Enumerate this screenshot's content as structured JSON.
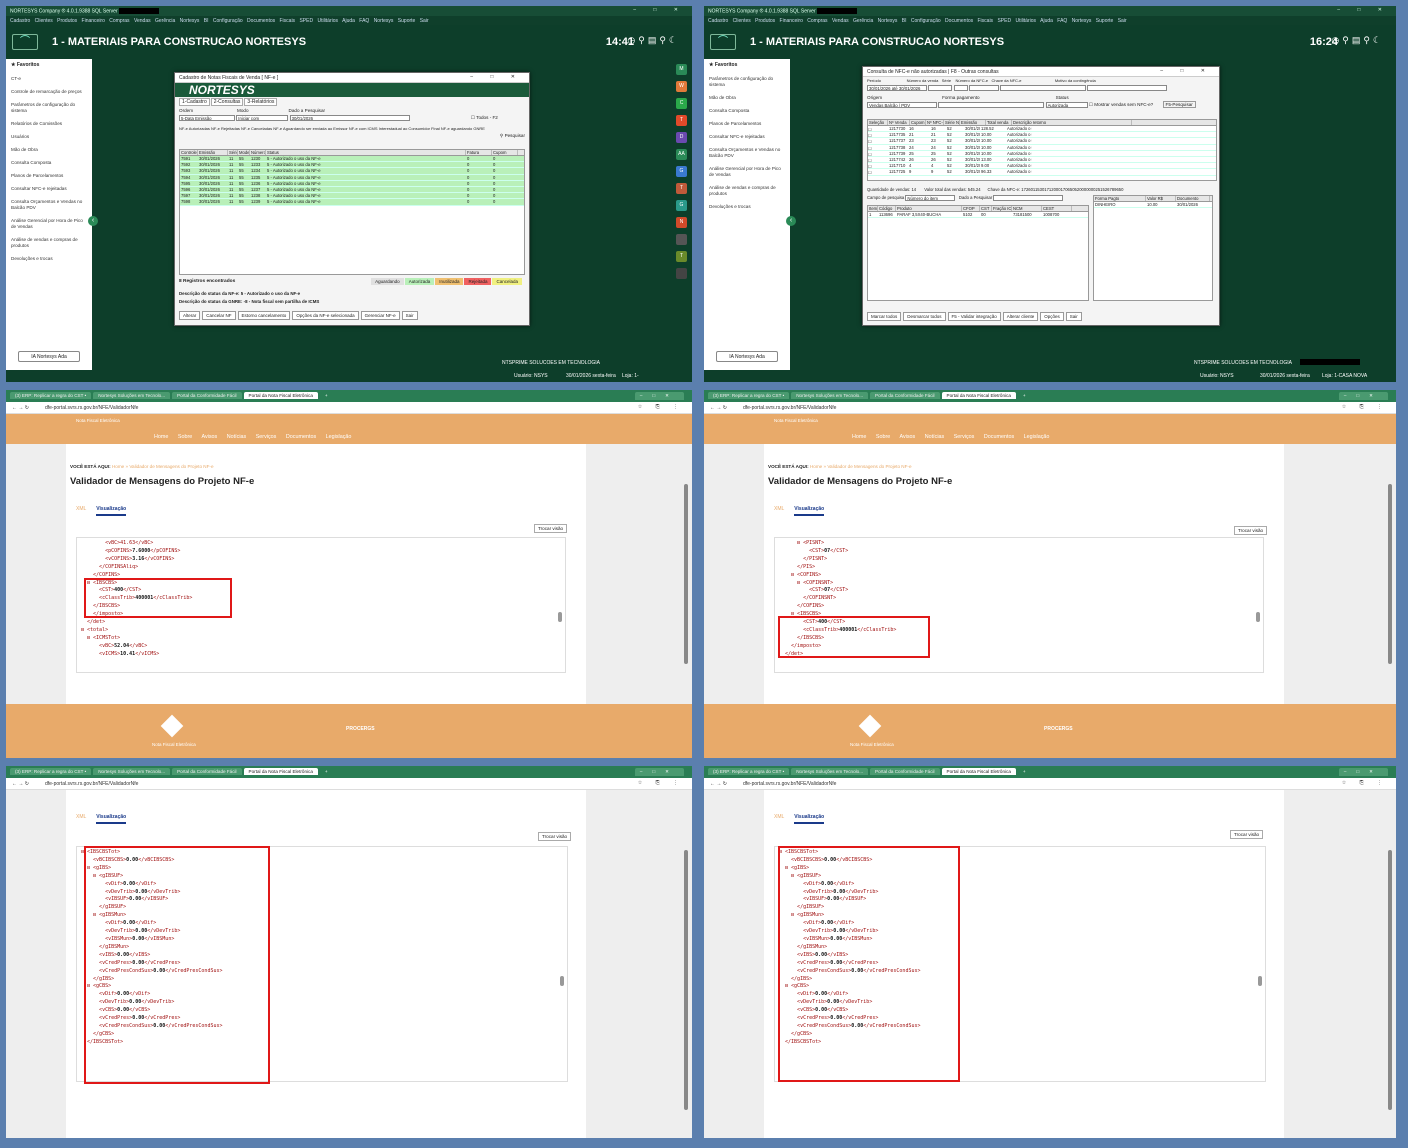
{
  "erp": {
    "window_title": "NORTESYS Company ® 4.0.1.9388 SQL Server",
    "menu": "Cadastro  Clientes  Produtos  Financeiro  Compras  Vendas  Gerência  Nortesys BI  Configuração  Documentos Fiscais  SPED  Utilitários  Ajuda  FAQ Nortesys  Suporte  Sair",
    "company": "1 - MATERIAIS PARA CONSTRUCAO NORTESYS",
    "favorites_label": "Favoritos",
    "ada_button": "IA Nortesys Ada",
    "footer_company": "NTSPRIME SOLUCOES EM TECNOLOGIA",
    "user": "Usuário: NSYS",
    "date": "30/01/2026 sexta-feira",
    "dock": [
      "M",
      "W",
      "C",
      "T",
      "D",
      "AA",
      "G",
      "T",
      "G",
      "N",
      "",
      "T",
      ""
    ]
  },
  "panel1": {
    "clock": "14:41",
    "sidebar": [
      "CT-e",
      "Controle de remarcação de preços",
      "Parâmetros de configuração do sistema",
      "Relatórios de Comissões",
      "Usuários",
      "Mão de Obra",
      "Consulta Composta",
      "Planos de Parcelamentos",
      "Consultar NFC-e rejeitadas",
      "Consulta Orçamentos e Vendas no Balcão PDV",
      "Análise Gerencial por Hora de Pico de Vendas",
      "Análise de vendas e compras de produtos",
      "Devoluções e trocas"
    ],
    "store": "Loja: 1-",
    "dialog": {
      "title": "Cadastro de Notas Fiscais de Venda [ NF-e ]",
      "banner": "NORTESYS",
      "tabs": [
        "1-Cadastro",
        "2-Consultas",
        "3-Relatórios"
      ],
      "ordem_label": "Ordem",
      "ordem_value": "5-Data Emissão",
      "modo_label": "Modo",
      "modo_value": "Iniciar com",
      "dado_label": "Dado a Pesquisar",
      "dado_value": "30/01/2026",
      "todos_label": "Todos - F2",
      "filters": "NF-e Autorizadas  NF-e Rejeitadas  NF-e Canceladas  NF-e Aguardando ser enviada ao Emissor  NF-e com ICMS Interestadual ao Consumidor Final  NF-e aguardando GNRE",
      "pesquisar": "Pesquisar",
      "columns": [
        "Controle",
        "Emissão",
        "Série",
        "Modelo",
        "Número",
        "Status",
        "Fatura",
        "Cupom"
      ],
      "rows": [
        [
          "7591",
          "30/01/2026",
          "11",
          "55",
          "1230",
          "5 - Autorizado o uso da NF-e",
          "0",
          "0"
        ],
        [
          "7592",
          "30/01/2026",
          "11",
          "55",
          "1233",
          "5 - Autorizado o uso da NF-e",
          "0",
          "0"
        ],
        [
          "7593",
          "30/01/2026",
          "11",
          "55",
          "1234",
          "5 - Autorizado o uso da NF-e",
          "0",
          "0"
        ],
        [
          "7594",
          "30/01/2026",
          "11",
          "55",
          "1235",
          "5 - Autorizado o uso da NF-e",
          "0",
          "0"
        ],
        [
          "7595",
          "30/01/2026",
          "11",
          "55",
          "1236",
          "5 - Autorizado o uso da NF-e",
          "0",
          "0"
        ],
        [
          "7596",
          "30/01/2026",
          "11",
          "55",
          "1237",
          "5 - Autorizado o uso da NF-e",
          "0",
          "0"
        ],
        [
          "7597",
          "30/01/2026",
          "11",
          "55",
          "1238",
          "5 - Autorizado o uso da NF-e",
          "0",
          "0"
        ],
        [
          "7598",
          "30/01/2026",
          "11",
          "55",
          "1239",
          "5 - Autorizado o uso da NF-e",
          "0",
          "0"
        ]
      ],
      "count": "8 Registros encontrados",
      "legend": [
        "Aguardando",
        "Autorizada",
        "Inutilizada",
        "Rejeitada",
        "Cancelada"
      ],
      "desc1": "Descrição do status da NF-e:  5 - Autorizado o uso da NF-e",
      "desc2": "Descrição do status da GNRE:  -8 - Nota fiscal sem partilha de ICMS",
      "buttons": [
        "Alterar",
        "Cancelar NF",
        "Estorno cancelamento",
        "Opções da NF-e selecionada",
        "Gerenciar NF-e",
        "Sair"
      ]
    }
  },
  "panel2": {
    "clock": "16:24",
    "sidebar": [
      "Parâmetros de configuração do sistema",
      "Mão de Obra",
      "Consulta Composta",
      "Planos de Parcelamentos",
      "Consultar NFC-e rejeitadas",
      "Consulta Orçamentos e Vendas no Balcão PDV",
      "Análise Gerencial por Hora de Pico de Vendas",
      "Análise de vendas e compras de produtos",
      "Devoluções e trocas"
    ],
    "store": "Loja: 1-CASA NOVA",
    "dialog": {
      "title": "Consulta de NFC-e não autorizadas | F8 - Outras consultas",
      "labels": "Período                       Número da venda   Série    Número da NFC-e   Chave da NFC-e                              Motivo da contingência",
      "periodo": "30/01/2026  até  30/01/2026",
      "origem_label": "Origem",
      "origem_value": "Vendas Balcão / PDV",
      "forma_label": "Forma pagamento",
      "status_label": "Status",
      "status_value": "Autorizada",
      "mostrar": "Mostrar vendas sem NFC-e?",
      "pesquisar": "F5-Pesquisar",
      "columns": [
        "Seleção",
        "Nº Venda",
        "Cupom",
        "Nº NFC-e",
        "Série NFC-e",
        "Emissão",
        "Total venda",
        "Descrição retorno"
      ],
      "rows": [
        [
          "1217730",
          "16",
          "16",
          "52",
          "30/01/2026",
          "128.52",
          "Autorizado o uso da NF-e"
        ],
        [
          "1217735",
          "21",
          "21",
          "52",
          "30/01/2026",
          "10.00",
          "Autorizado o uso da NF-e"
        ],
        [
          "1217737",
          "23",
          "23",
          "52",
          "30/01/2026",
          "10.00",
          "Autorizado o uso da NF-e"
        ],
        [
          "1217738",
          "24",
          "24",
          "52",
          "30/01/2026",
          "10.00",
          "Autorizado o uso da NF-e"
        ],
        [
          "1217739",
          "25",
          "25",
          "52",
          "30/01/2026",
          "10.00",
          "Autorizado o uso da NF-e"
        ],
        [
          "1217742",
          "26",
          "26",
          "52",
          "30/01/2026",
          "13.00",
          "Autorizado o uso da NF-e"
        ],
        [
          "1217710",
          "4",
          "4",
          "52",
          "30/01/2026",
          "9.00",
          "Autorizado o uso da NF-e"
        ],
        [
          "1217725",
          "9",
          "9",
          "52",
          "30/01/2026",
          "96.33",
          "Autorizado o uso da NF-e"
        ]
      ],
      "qtd": "Quantidade de vendas:  14",
      "valor": "Valor total das vendas:  545.24",
      "chave": "Chave da NFC-e:  17260115301712000170650520000000251526789650",
      "campo_label": "Campo de pesquisa",
      "campo_value": "Número do item",
      "dado_label": "Dado a Pesquisar",
      "item_columns": [
        "Item",
        "Código",
        "Produto",
        "CFOP",
        "CST",
        "Fração ICMS",
        "NCM",
        "CEST"
      ],
      "item_row": [
        "1",
        "113696",
        "PARAF 3,5X40-BUCHA",
        "5102",
        "00",
        "",
        "73181500",
        "1008700"
      ],
      "pay_columns": [
        "Forma Pagto",
        "Valor R$",
        "Documento"
      ],
      "pay_row": [
        "DINHEIRO",
        "10.00",
        "30/01/2026"
      ],
      "buttons": [
        "Marcar todos",
        "Desmarcar todos",
        "F5 - Validar integração",
        "Alterar cliente",
        "Opções",
        "Sair"
      ]
    }
  },
  "browser": {
    "tabs": [
      "(3) ERP: Replicar a regra do CST •",
      "Nortesys Soluções em Tecnolo...",
      "Portal da Conformidade Fácil",
      "Portal da Nota Fiscal Eletrônica"
    ],
    "url": "dfe-portal.svrs.rs.gov.br/NFE/ValidadorNfe",
    "nav": "Home   Sobre   Avisos   Notícias   Serviços   Documentos   Legislação",
    "brand": "Nota Fiscal Eletrônica",
    "crumb_prefix": "VOCÊ ESTÁ AQUI:",
    "crumb_path": "Home  »  Validador de Mensagens do Projeto NF-e",
    "page_title": "Validador de Mensagens do Projeto NF-e",
    "tab_xml": "XML",
    "tab_vis": "Visualização",
    "trocar": "Trocar visão",
    "footer_name": "Nota Fiscal Eletrônica",
    "footer_partner": "PROCERGS"
  },
  "xml3": [
    [
      "        <vBC>41.63</vBC>",
      ""
    ],
    [
      "        <pCOFINS>",
      "7.6000",
      "</pCOFINS>"
    ],
    [
      "        <vCOFINS>",
      "3.16",
      "</vCOFINS>"
    ],
    [
      "      </COFINSAliq>",
      ""
    ],
    [
      "    </COFINS>",
      ""
    ],
    [
      "  ⊟ <IBSCBS>",
      ""
    ],
    [
      "      <CST>",
      "400",
      "</CST>"
    ],
    [
      "      <cClassTrib>",
      "400001",
      "</cClassTrib>"
    ],
    [
      "    </IBSCBS>",
      ""
    ],
    [
      "    </imposto>",
      ""
    ],
    [
      "  </det>",
      ""
    ],
    [
      "⊟ <total>",
      ""
    ],
    [
      "  ⊟ <ICMSTot>",
      ""
    ],
    [
      "      <vBC>",
      "52.04",
      "</vBC>"
    ],
    [
      "      <vICMS>",
      "10.41",
      "</vICMS>"
    ]
  ],
  "xml4": [
    [
      "      ⊟ <PISNT>",
      ""
    ],
    [
      "          <CST>",
      "07",
      "</CST>"
    ],
    [
      "        </PISNT>",
      ""
    ],
    [
      "      </PIS>",
      ""
    ],
    [
      "    ⊟ <COFINS>",
      ""
    ],
    [
      "      ⊟ <COFINSNT>",
      ""
    ],
    [
      "          <CST>",
      "07",
      "</CST>"
    ],
    [
      "        </COFINSNT>",
      ""
    ],
    [
      "      </COFINS>",
      ""
    ],
    [
      "    ⊟ <IBSCBS>",
      ""
    ],
    [
      "        <CST>",
      "400",
      "</CST>"
    ],
    [
      "        <cClassTrib>",
      "400001",
      "</cClassTrib>"
    ],
    [
      "      </IBSCBS>",
      ""
    ],
    [
      "    </imposto>",
      ""
    ],
    [
      "  </det>",
      ""
    ]
  ],
  "xml5": [
    [
      "⊟ <IBSCBSTot>",
      ""
    ],
    [
      "    <vBCIBSCBS>",
      "0.00",
      "</vBCIBSCBS>"
    ],
    [
      "  ⊟ <gIBS>",
      ""
    ],
    [
      "    ⊟ <gIBSUF>",
      ""
    ],
    [
      "        <vDif>",
      "0.00",
      "</vDif>"
    ],
    [
      "        <vDevTrib>",
      "0.00",
      "</vDevTrib>"
    ],
    [
      "        <vIBSUF>",
      "0.00",
      "</vIBSUF>"
    ],
    [
      "      </gIBSUF>",
      ""
    ],
    [
      "    ⊟ <gIBSMun>",
      ""
    ],
    [
      "        <vDif>",
      "0.00",
      "</vDif>"
    ],
    [
      "        <vDevTrib>",
      "0.00",
      "</vDevTrib>"
    ],
    [
      "        <vIBSMun>",
      "0.00",
      "</vIBSMun>"
    ],
    [
      "      </gIBSMun>",
      ""
    ],
    [
      "      <vIBS>",
      "0.00",
      "</vIBS>"
    ],
    [
      "      <vCredPres>",
      "0.00",
      "</vCredPres>"
    ],
    [
      "      <vCredPresCondSus>",
      "0.00",
      "</vCredPresCondSus>"
    ],
    [
      "    </gIBS>",
      ""
    ],
    [
      "  ⊟ <gCBS>",
      ""
    ],
    [
      "      <vDif>",
      "0.00",
      "</vDif>"
    ],
    [
      "      <vDevTrib>",
      "0.00",
      "</vDevTrib>"
    ],
    [
      "      <vCBS>",
      "0.00",
      "</vCBS>"
    ],
    [
      "      <vCredPres>",
      "0.00",
      "</vCredPres>"
    ],
    [
      "      <vCredPresCondSus>",
      "0.00",
      "</vCredPresCondSus>"
    ],
    [
      "    </gCBS>",
      ""
    ],
    [
      "  </IBSCBSTot>",
      ""
    ]
  ],
  "colors": {
    "erp_green": "#0d3e2a",
    "site_orange": "#e8aa6a",
    "highlight_red": "#e01818",
    "row_green": "#b9f0b9"
  }
}
